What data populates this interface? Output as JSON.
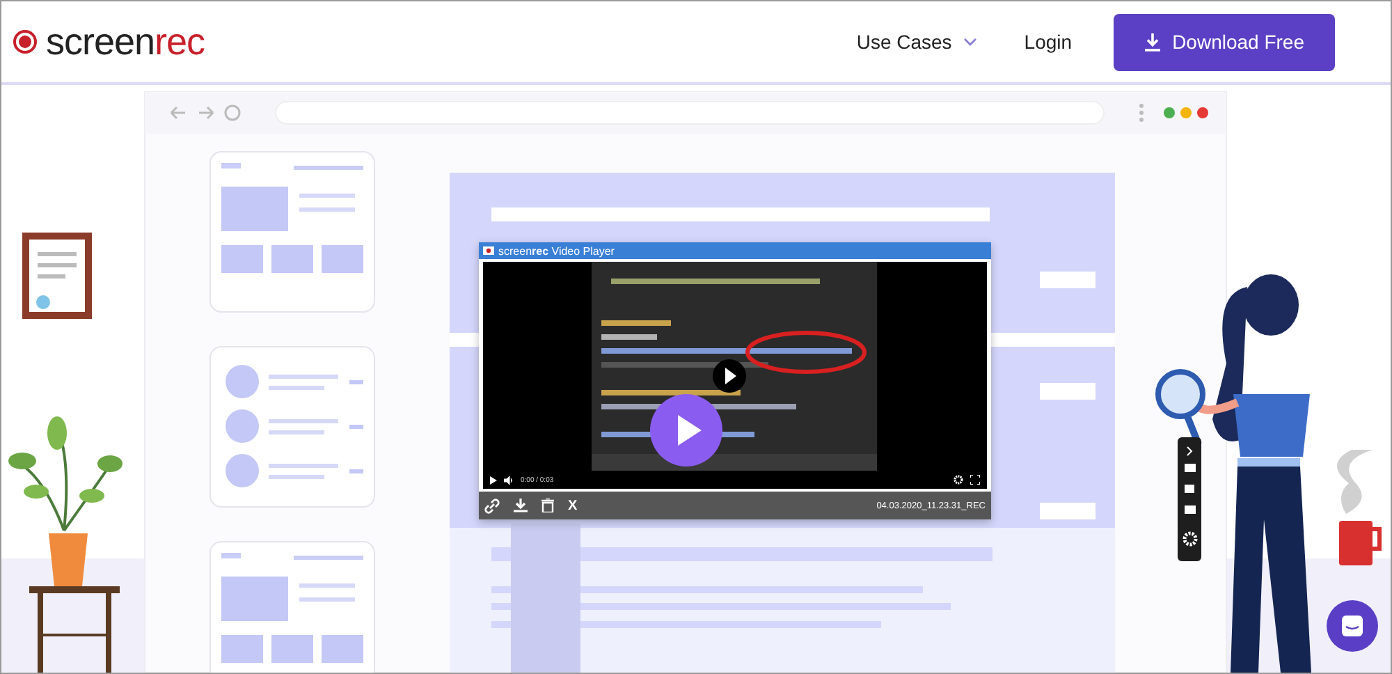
{
  "header": {
    "logo_light": "screen",
    "logo_bold": "rec",
    "nav": [
      {
        "label": "Use Cases",
        "kind": "dropdown"
      },
      {
        "label": "Login",
        "kind": "link"
      }
    ],
    "cta": "Download Free"
  },
  "player": {
    "title": "screen**rec** Video Player",
    "time": "0:00 / 0:03",
    "close_label": "X",
    "filename": "04.03.2020_11.23.31_REC"
  }
}
